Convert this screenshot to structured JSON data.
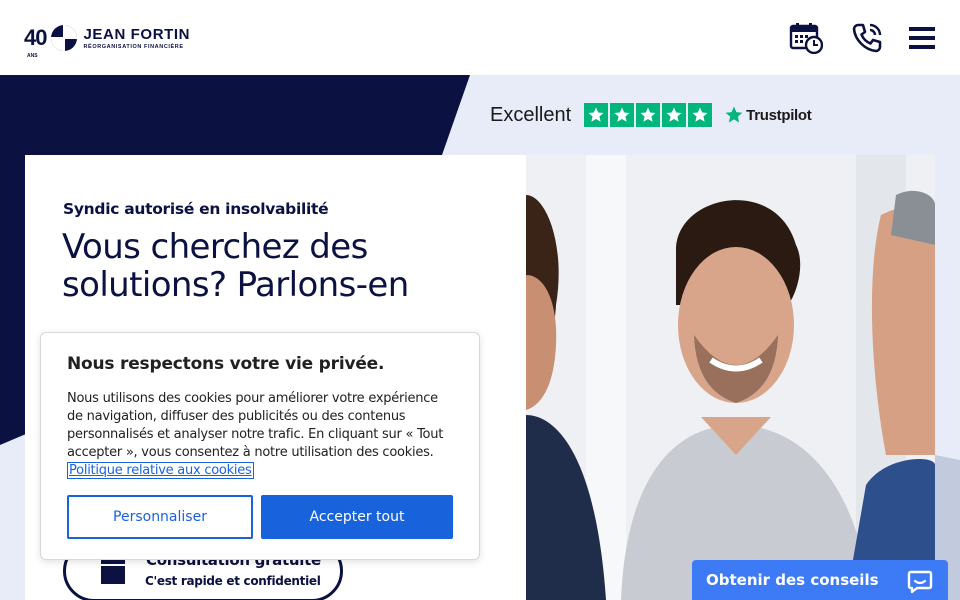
{
  "header": {
    "logo": {
      "anniversary": "40",
      "anniversary_sub": "ANS",
      "name": "JEAN FORTIN",
      "tagline": "RÉORGANISATION FINANCIÈRE"
    },
    "icons": [
      "calendar-clock-icon",
      "phone-icon",
      "menu-icon"
    ]
  },
  "trustpilot": {
    "rating_label": "Excellent",
    "stars": 5,
    "brand": "Trustpilot"
  },
  "hero": {
    "eyebrow": "Syndic autorisé en insolvabilité",
    "headline": "Vous cherchez des solutions? Parlons-en",
    "cta": {
      "title": "Consultation gratuite",
      "subtitle": "C'est rapide et confidentiel",
      "icon": "calendar-icon"
    }
  },
  "cookie_banner": {
    "title": "Nous respectons votre vie privée.",
    "body": "Nous utilisons des cookies pour améliorer votre expérience de navigation, diffuser des publicités ou des contenus personnalisés et analyser notre trafic. En cliquant sur « Tout accepter », vous consentez à notre utilisation des cookies.",
    "link": "Politique relative aux cookies",
    "customize_label": "Personnaliser",
    "accept_label": "Accepter tout"
  },
  "chat": {
    "label": "Obtenir des conseils",
    "icon": "chat-bubble-icon"
  },
  "colors": {
    "navy": "#0b1140",
    "light_bg": "#e8ecf8",
    "trustpilot_green": "#00b67a",
    "cookie_blue": "#1863dc",
    "chat_blue": "#3d7bf6"
  }
}
